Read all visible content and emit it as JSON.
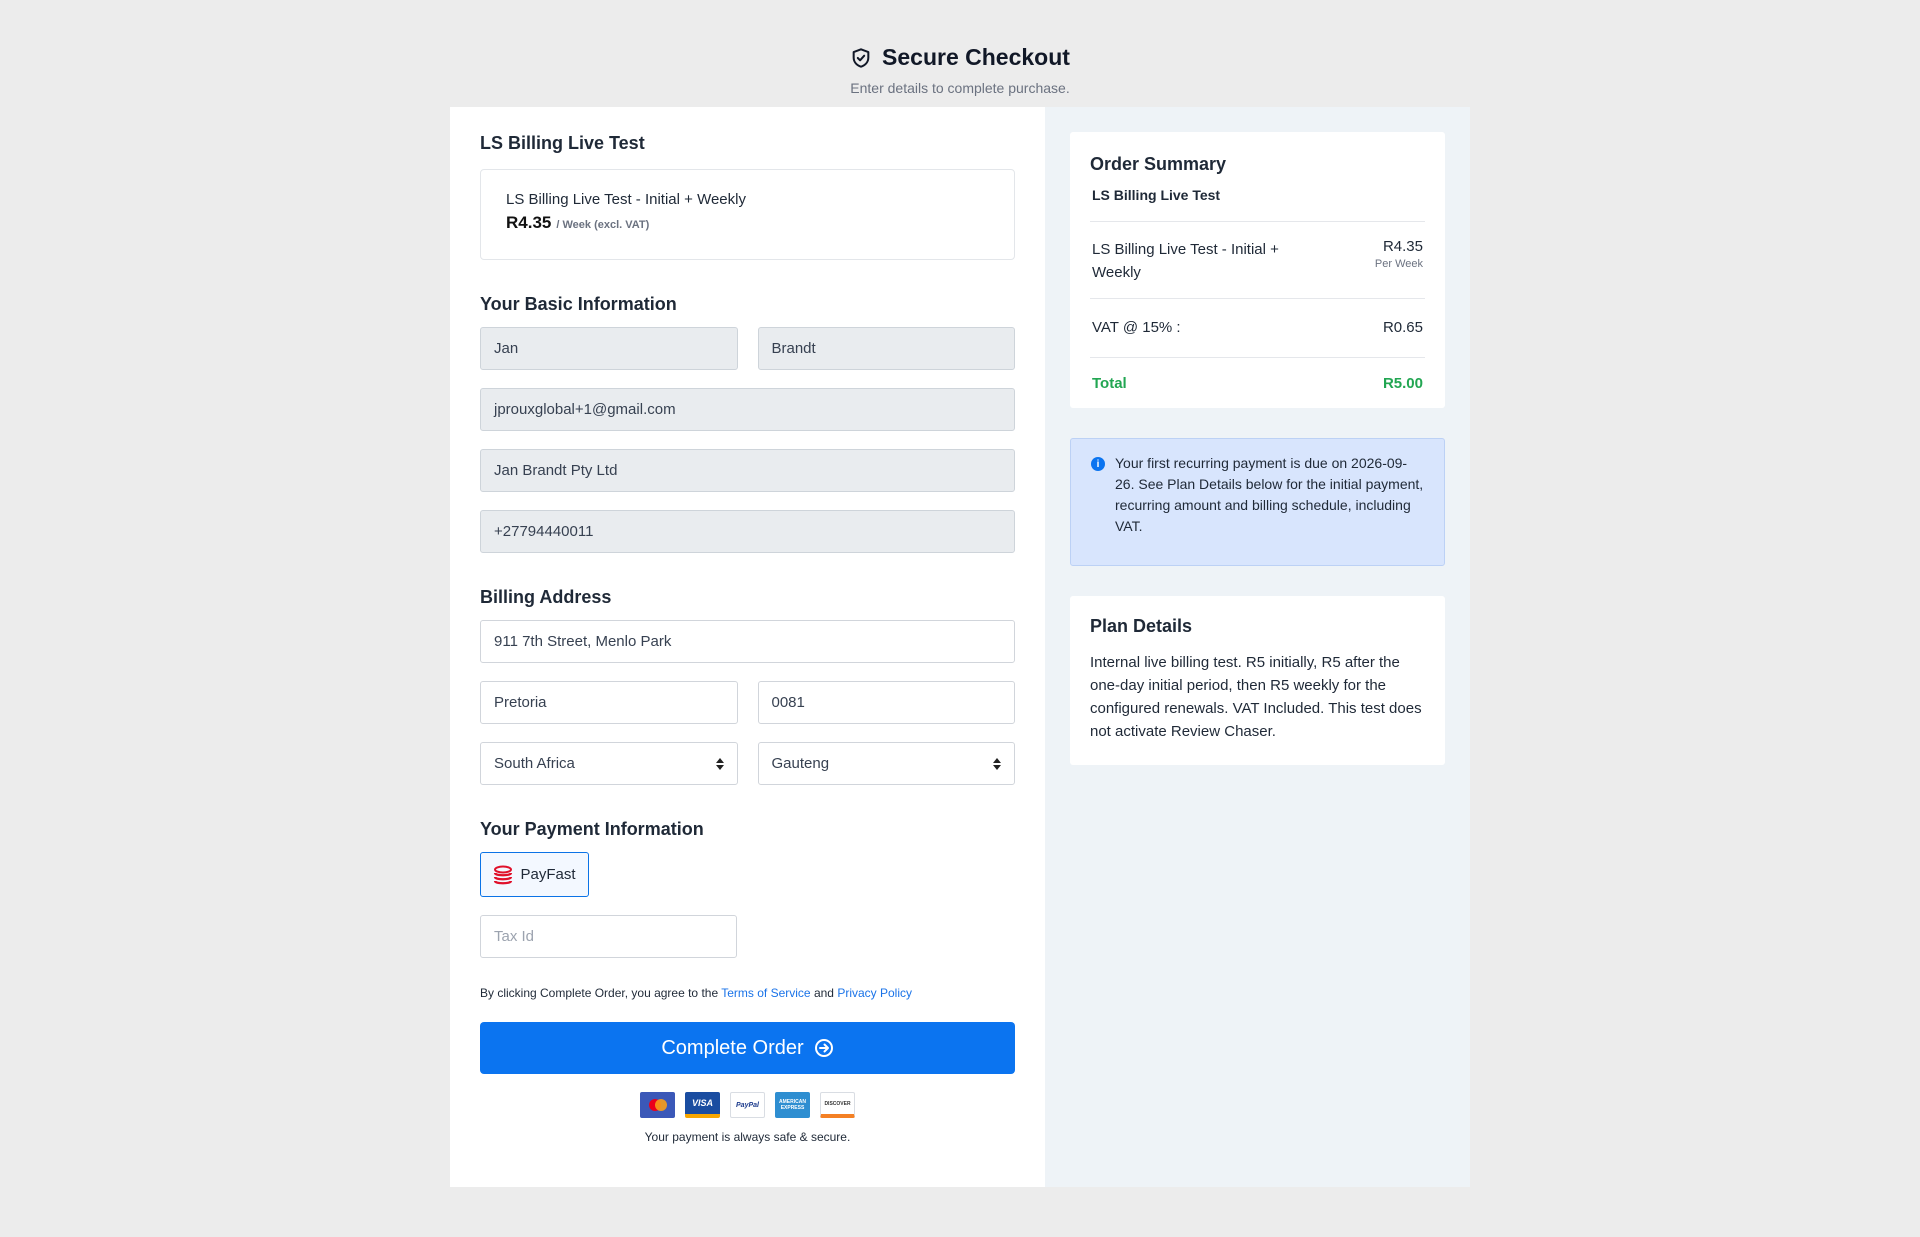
{
  "header": {
    "title": "Secure Checkout",
    "subtitle": "Enter details to complete purchase."
  },
  "product": {
    "section_title": "LS Billing Live Test",
    "name": "LS Billing Live Test - Initial + Weekly",
    "price": "R4.35",
    "price_unit": "/ Week (excl. VAT)"
  },
  "basic_info": {
    "title": "Your Basic Information",
    "first_name": "Jan",
    "last_name": "Brandt",
    "email": "jprouxglobal+1@gmail.com",
    "company": "Jan Brandt Pty Ltd",
    "phone": "+27794440011"
  },
  "billing": {
    "title": "Billing Address",
    "street": "911 7th Street, Menlo Park",
    "city": "Pretoria",
    "postal_code": "0081",
    "country": "South Africa",
    "state": "Gauteng"
  },
  "payment": {
    "title": "Your Payment Information",
    "method_label": "PayFast",
    "tax_placeholder": "Tax Id",
    "terms_prefix": "By clicking Complete Order, you agree to the",
    "terms_link": "Terms of Service",
    "terms_and": "and",
    "privacy_link": "Privacy Policy",
    "submit_label": "Complete Order",
    "secure_text": "Your payment is always safe & secure.",
    "card_logos": [
      "mastercard-icon",
      "visa-icon",
      "paypal-icon",
      "amex-icon",
      "discover-icon"
    ],
    "card_texts": {
      "visa": "VISA",
      "paypal": "PayPal",
      "amex": "AMERICAN EXPRESS",
      "discover": "DISCOVER"
    }
  },
  "summary": {
    "title": "Order Summary",
    "product": "LS Billing Live Test",
    "line_label": "LS Billing Live Test - Initial + Weekly",
    "line_amount": "R4.35",
    "line_period": "Per Week",
    "vat_label": "VAT @ 15% :",
    "vat_amount": "R0.65",
    "total_label": "Total",
    "total_amount": "R5.00"
  },
  "notice": {
    "text": "Your first recurring payment is due on 2026-09-26. See Plan Details below for the initial payment, recurring amount and billing schedule, including VAT."
  },
  "plan": {
    "title": "Plan Details",
    "text": "Internal live billing test. R5 initially, R5 after the one-day initial period, then R5 weekly for the configured renewals. VAT Included. This test does not activate Review Chaser."
  },
  "colors": {
    "primary": "#0b74f0",
    "total_green": "#22a652",
    "notice_bg": "#d8e5fd",
    "page_bg": "#ececec"
  }
}
